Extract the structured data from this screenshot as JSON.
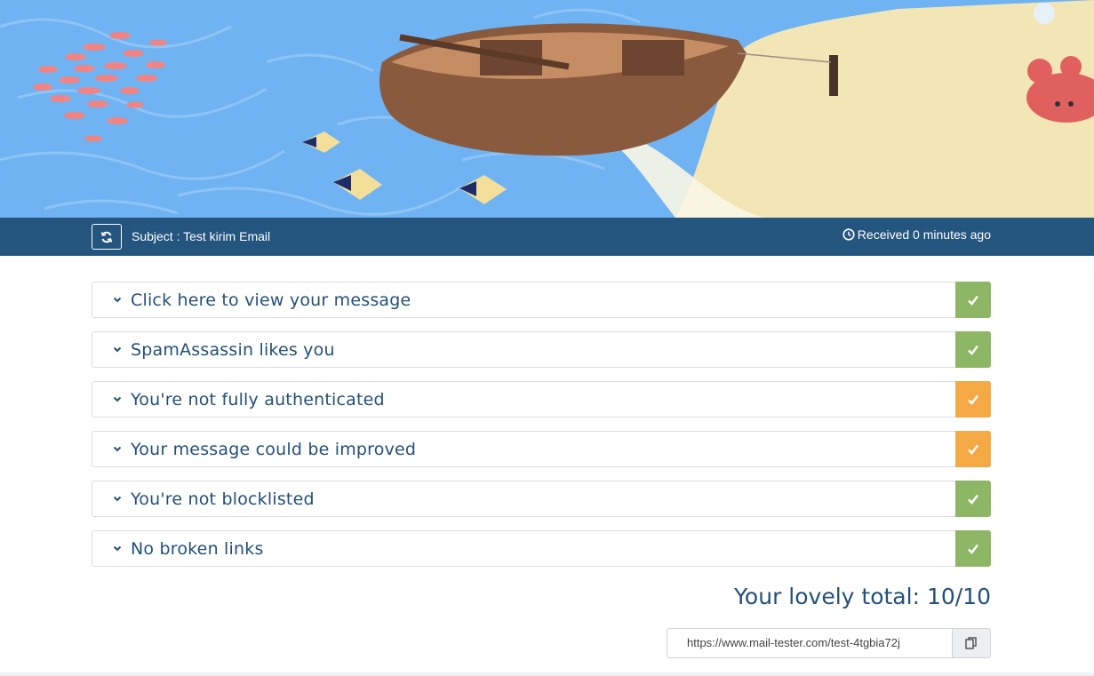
{
  "header": {
    "subject": "Subject : Test kirim Email",
    "received": "Received 0 minutes ago"
  },
  "checks": [
    {
      "label": "Click here to view your message",
      "status": "pass",
      "color": "#8db665"
    },
    {
      "label": "SpamAssassin likes you",
      "status": "pass",
      "color": "#8db665"
    },
    {
      "label": "You're not fully authenticated",
      "status": "warn",
      "color": "#f5a944"
    },
    {
      "label": "Your message could be improved",
      "status": "warn",
      "color": "#f5a944"
    },
    {
      "label": "You're not blocklisted",
      "status": "pass",
      "color": "#8db665"
    },
    {
      "label": "No broken links",
      "status": "pass",
      "color": "#8db665"
    }
  ],
  "icons": {
    "refresh": "refresh-icon",
    "clock": "clock-icon",
    "chevron": "chevron-down-icon",
    "check": "check-icon",
    "copy": "copy-icon"
  },
  "total": "Your lovely total: 10/10",
  "result_url": "https://www.mail-tester.com/test-4tgbia72j",
  "colors": {
    "header_bar": "#24557f",
    "text": "#24507a",
    "pass": "#8db665",
    "warn": "#f5a944"
  }
}
